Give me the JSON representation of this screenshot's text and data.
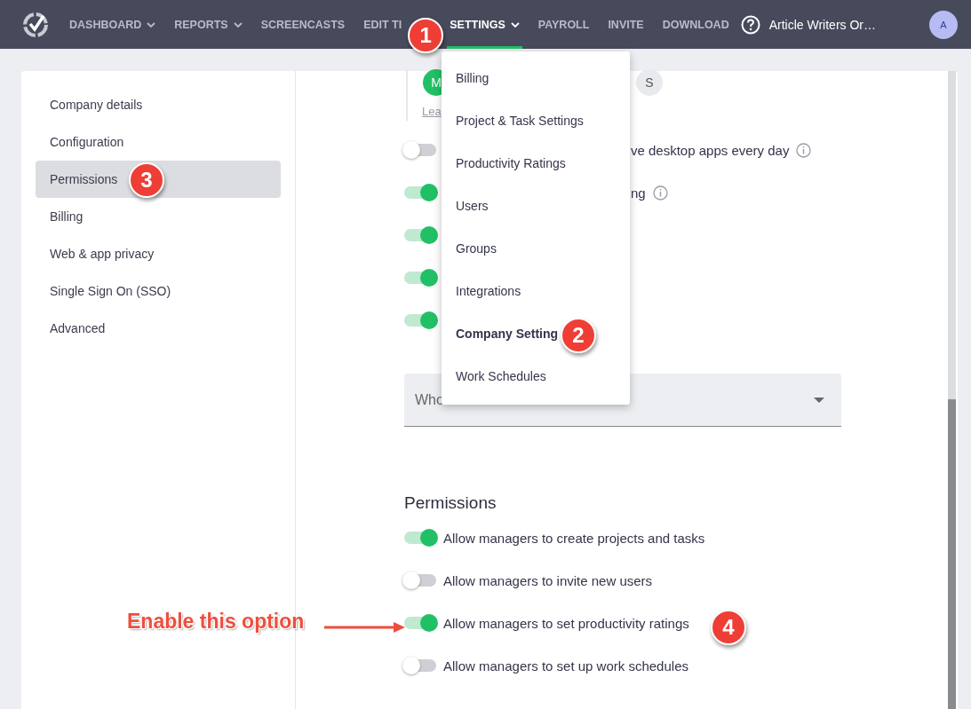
{
  "nav": {
    "items": [
      {
        "label": "DASHBOARD",
        "has_menu": true,
        "selected": false
      },
      {
        "label": "REPORTS",
        "has_menu": true,
        "selected": false
      },
      {
        "label": "SCREENCASTS",
        "has_menu": false,
        "selected": false
      },
      {
        "label": "EDIT TI",
        "has_menu": false,
        "selected": false
      },
      {
        "label": "SETTINGS",
        "has_menu": true,
        "selected": true
      },
      {
        "label": "PAYROLL",
        "has_menu": false,
        "selected": false
      },
      {
        "label": "INVITE",
        "has_menu": false,
        "selected": false
      },
      {
        "label": "DOWNLOAD",
        "has_menu": false,
        "selected": false
      }
    ],
    "account": "Article Writers Or…",
    "avatar": "A"
  },
  "settings_menu": [
    {
      "label": "Billing",
      "selected": false
    },
    {
      "label": "Project & Task Settings",
      "selected": false
    },
    {
      "label": "Productivity Ratings",
      "selected": false
    },
    {
      "label": "Users",
      "selected": false
    },
    {
      "label": "Groups",
      "selected": false
    },
    {
      "label": "Integrations",
      "selected": false
    },
    {
      "label": "Company Setting",
      "selected": true
    },
    {
      "label": "Work Schedules",
      "selected": false
    }
  ],
  "sidebar": {
    "items": [
      {
        "label": "Company details",
        "selected": false
      },
      {
        "label": "Configuration",
        "selected": false
      },
      {
        "label": "Permissions",
        "selected": true
      },
      {
        "label": "Billing",
        "selected": false
      },
      {
        "label": "Web & app privacy",
        "selected": false
      },
      {
        "label": "Single Sign On (SSO)",
        "selected": false
      },
      {
        "label": "Advanced",
        "selected": false
      }
    ]
  },
  "upper": {
    "avatars": [
      {
        "initial": "M",
        "color": "#22c066"
      },
      {
        "initial": "S",
        "color": "#e9eaed"
      }
    ],
    "link": "Lea",
    "toggles": [
      {
        "on": false,
        "text": "ve desktop apps every day",
        "info": true
      },
      {
        "on": true,
        "text": "ng",
        "info": true
      },
      {
        "on": true
      },
      {
        "on": true
      },
      {
        "on": true
      }
    ]
  },
  "payroll_select": {
    "placeholder": "Who"
  },
  "permissions": {
    "title": "Permissions",
    "toggles": [
      {
        "on": true,
        "text": "Allow managers to create projects and tasks"
      },
      {
        "on": false,
        "text": "Allow managers to invite new users"
      },
      {
        "on": true,
        "text": "Allow managers to set productivity ratings"
      },
      {
        "on": false,
        "text": "Allow managers to set up work schedules"
      }
    ]
  },
  "annotations": {
    "callout": "Enable this option",
    "badges": [
      "1",
      "2",
      "3",
      "4"
    ]
  }
}
